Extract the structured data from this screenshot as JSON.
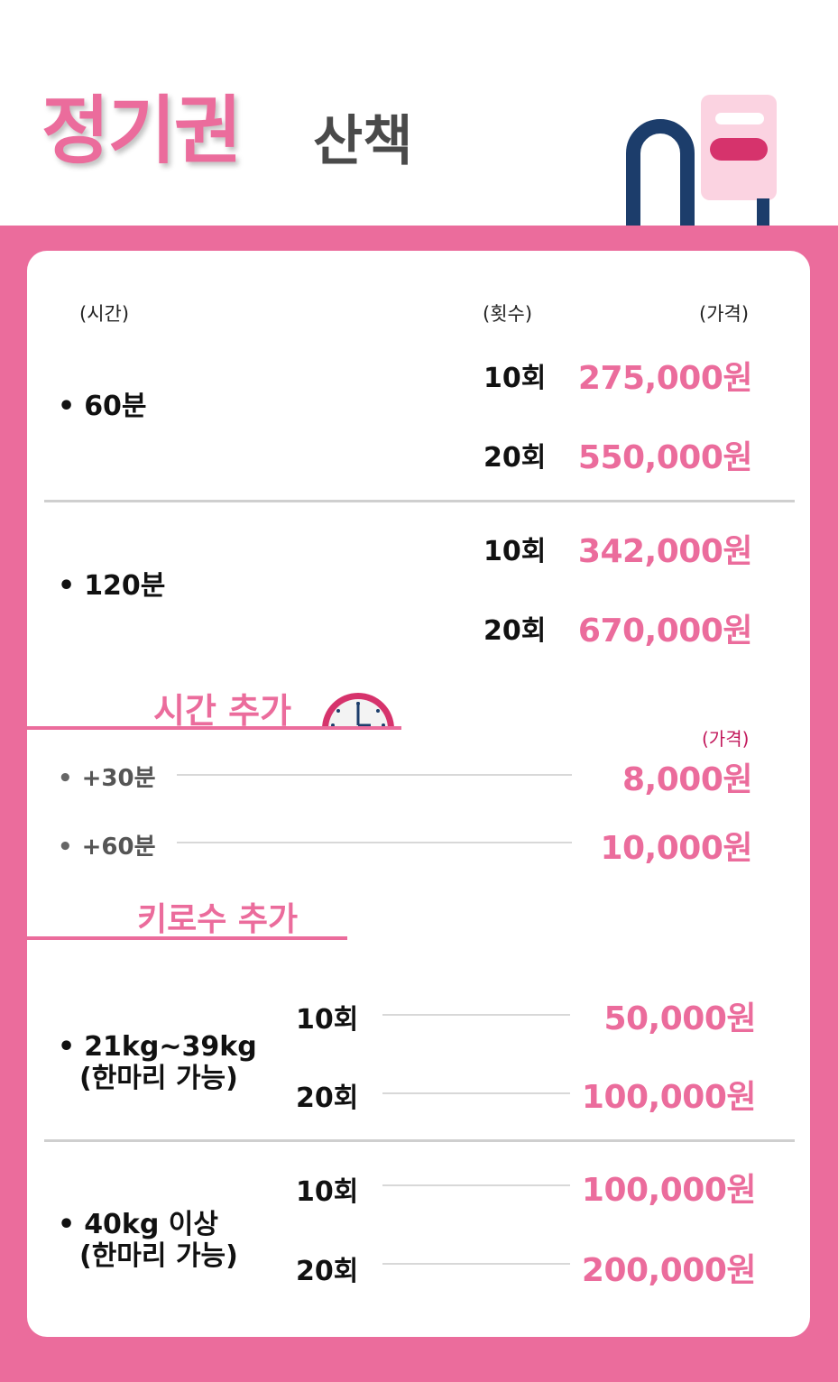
{
  "colors": {
    "accent": "#eb6c9c",
    "accent_dark": "#d6336c",
    "navy": "#1c3d6b",
    "light_pink": "#fbd3e1"
  },
  "header": {
    "title_main": "정기권",
    "title_sub": "산책"
  },
  "columns": {
    "time": "(시간)",
    "count": "(횟수)",
    "price": "(가격)"
  },
  "plans": [
    {
      "label": "60분",
      "options": [
        {
          "count": "10회",
          "price": "275,000원"
        },
        {
          "count": "20회",
          "price": "550,000원"
        }
      ]
    },
    {
      "label": "120분",
      "options": [
        {
          "count": "10회",
          "price": "342,000원"
        },
        {
          "count": "20회",
          "price": "670,000원"
        }
      ]
    }
  ],
  "time_add": {
    "title": "시간 추가",
    "icon": "clock-icon",
    "price_header": "(가격)",
    "items": [
      {
        "label": "+30분",
        "price": "8,000원"
      },
      {
        "label": "+60분",
        "price": "10,000원"
      }
    ]
  },
  "weight_add": {
    "title": "키로수 추가",
    "groups": [
      {
        "label": "21kg~39kg",
        "note": "(한마리 가능)",
        "options": [
          {
            "count": "10회",
            "price": "50,000원"
          },
          {
            "count": "20회",
            "price": "100,000원"
          }
        ]
      },
      {
        "label": "40kg 이상",
        "note": "(한마리 가능)",
        "options": [
          {
            "count": "10회",
            "price": "100,000원"
          },
          {
            "count": "20회",
            "price": "200,000원"
          }
        ]
      }
    ]
  }
}
